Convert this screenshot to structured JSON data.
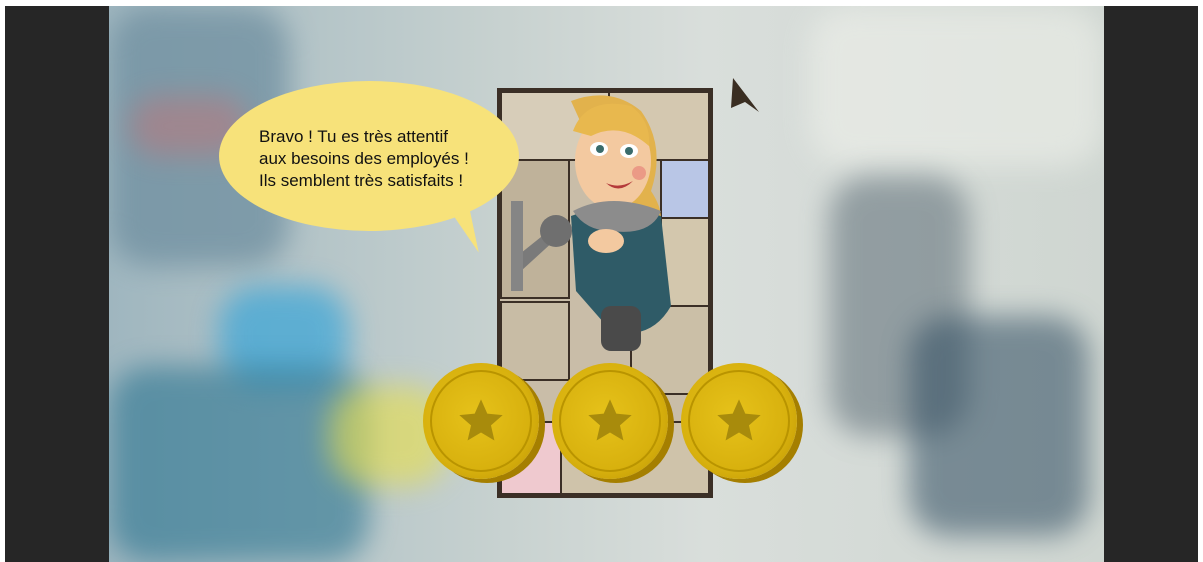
{
  "dialog": {
    "line1": "Bravo ! Tu es très attentif",
    "line2": "aux besoins des employés !",
    "line3": "Ils semblent très satisfaits !"
  },
  "rating": {
    "stars_earned": 3,
    "stars_total": 3
  },
  "icons": {
    "star": "star-icon",
    "cursor": "arrow-cursor-icon"
  },
  "colors": {
    "coin": "#d8b10e",
    "star": "#a88b0c",
    "bubble": "#f7e27a",
    "frame": "#262626"
  }
}
